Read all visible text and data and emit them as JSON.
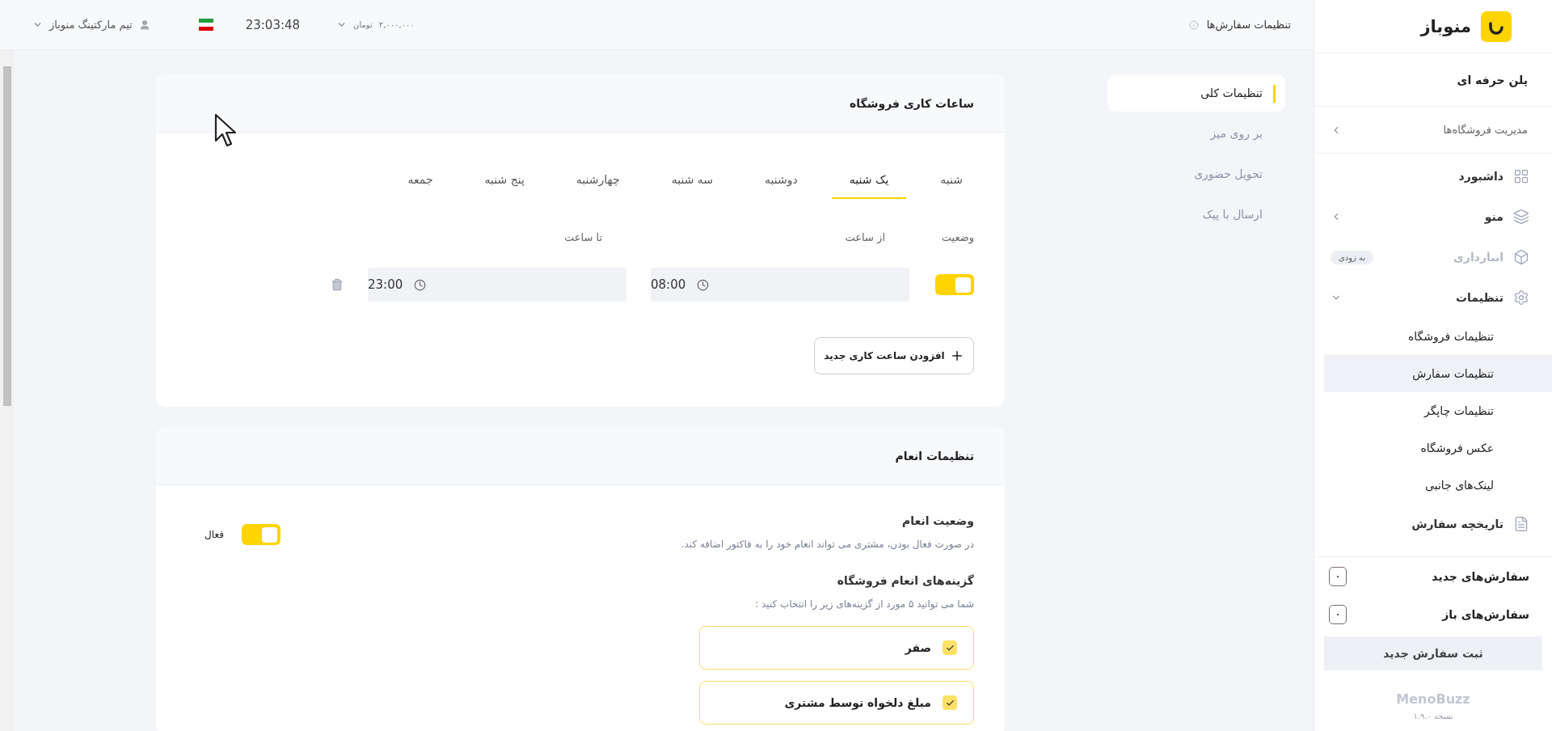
{
  "top_bar": {
    "page_title": "تنظیمات سفارش‌ها",
    "balance": "۲,۰۰۰,۰۰۰",
    "currency": "تومان",
    "time": "23:03:48",
    "user": "تیم مارکتینگ منوباز"
  },
  "sidebar": {
    "logo_text": "منوباز",
    "plan": "پلن حرفه ای",
    "store_management": "مدیریت فروشگاه‌ها",
    "items": [
      {
        "kind": "dashboard",
        "label": "داشبورد",
        "disabled": false
      },
      {
        "kind": "menu",
        "label": "منو",
        "disabled": false,
        "expanded": false
      },
      {
        "kind": "inventory",
        "label": "انبارداری",
        "disabled": true,
        "badge": "به زودی"
      },
      {
        "kind": "settings",
        "label": "تنظیمات",
        "disabled": false,
        "expanded": true,
        "children": [
          {
            "label": "تنظیمات فروشگاه",
            "selected": false
          },
          {
            "label": "تنظیمات سفارش",
            "selected": true
          },
          {
            "label": "تنظیمات چاپگر",
            "selected": false
          },
          {
            "label": "عکس فروشگاه",
            "selected": false
          },
          {
            "label": "لینک‌های جانبی",
            "selected": false
          }
        ]
      },
      {
        "kind": "history",
        "label": "تاریخچه سفارش",
        "disabled": false
      }
    ],
    "counters": [
      {
        "label": "سفارش‌های جدید",
        "count": "۰"
      },
      {
        "label": "سفارش‌های باز",
        "count": "۰"
      }
    ],
    "new_order_button": "ثبت سفارش جدید",
    "brand": "MenoBuzz",
    "version": "نسخه ۱.۹.۰"
  },
  "settings_nav": [
    {
      "label": "تنظیمات کلی",
      "selected": true
    },
    {
      "label": "بر روی میز",
      "selected": false
    },
    {
      "label": "تحویل حضوری",
      "selected": false
    },
    {
      "label": "ارسال با پیک",
      "selected": false
    }
  ],
  "working_hours": {
    "title": "ساعات کاری فروشگاه",
    "days": [
      {
        "label": "شنبه",
        "selected": false
      },
      {
        "label": "یک شنبه",
        "selected": true
      },
      {
        "label": "دوشنبه",
        "selected": false
      },
      {
        "label": "سه شنبه",
        "selected": false
      },
      {
        "label": "چهارشنبه",
        "selected": false
      },
      {
        "label": "پنج شنبه",
        "selected": false
      },
      {
        "label": "جمعه",
        "selected": false
      }
    ],
    "columns": [
      "وضعیت",
      "از ساعت",
      "تا ساعت"
    ],
    "rows": [
      {
        "on": true,
        "from": "08:00",
        "to": "23:00"
      }
    ],
    "add_button": "افزودن ساعت کاری جدید"
  },
  "tip_settings": {
    "title": "تنظیمات انعام",
    "status_title": "وضعیت انعام",
    "status_on": true,
    "status_label": "فعال",
    "description": "در صورت فعال بودن، مشتری می تواند انعام خود را به فاکتور اضافه کند.",
    "options_title": "گزینه‌های انعام فروشگاه",
    "options_hint": "شما می توانید ۵ مورد از گزینه‌های زیر را انتخاب کنید :",
    "options": [
      {
        "label": "صفر",
        "checked": true
      },
      {
        "label": "مبلغ دلخواه توسط مشتری",
        "checked": true
      }
    ]
  }
}
